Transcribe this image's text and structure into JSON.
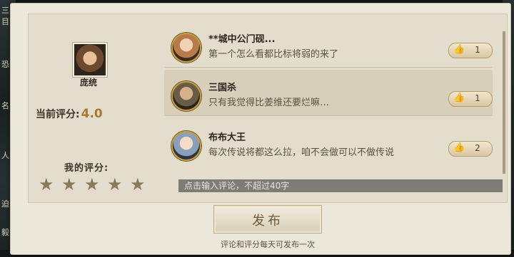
{
  "backdrop": {
    "left_glyphs": [
      "三目",
      "恐",
      "名",
      "人",
      "迫",
      "毅"
    ]
  },
  "hero": {
    "name": "庞统",
    "avatar_icon": "hero-portrait-icon"
  },
  "rating": {
    "current_label": "当前评分:",
    "current_value": "4.0",
    "my_label": "我的评分:",
    "my_stars": 5
  },
  "comments": [
    {
      "name": "**城中公门砚...",
      "text": "第一个怎么看都比标将弱的来了",
      "likes": "1",
      "highlighted": false,
      "avatar_color": "#b77b4a"
    },
    {
      "name": "三国杀",
      "text": "只有我觉得比姜维还要烂嘛…",
      "likes": "1",
      "highlighted": true,
      "avatar_color": "#6a5a48"
    },
    {
      "name": "布布大王",
      "text": "每次传说将都这么拉，咱不会做可以不做传说",
      "likes": "2",
      "highlighted": false,
      "avatar_color": "#8aa0b8"
    }
  ],
  "input": {
    "placeholder": "点击输入评论，不超过40字"
  },
  "publish_button": {
    "label": "发布"
  },
  "footnote": "评论和评分每天可发布一次",
  "colors": {
    "accent": "#a9782e",
    "panel": "#ece7db"
  }
}
